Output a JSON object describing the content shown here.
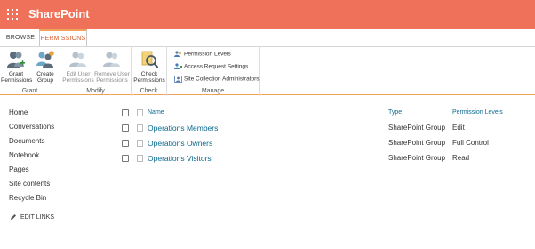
{
  "suite": {
    "app_name": "SharePoint"
  },
  "tabs": [
    {
      "label": "BROWSE"
    },
    {
      "label": "PERMISSIONS"
    }
  ],
  "ribbon": {
    "grant": {
      "label": "Grant",
      "buttons": [
        {
          "label": "Grant Permissions"
        },
        {
          "label": "Create Group"
        }
      ]
    },
    "modify": {
      "label": "Modify",
      "buttons": [
        {
          "label": "Edit User Permissions"
        },
        {
          "label": "Remove User Permissions"
        }
      ]
    },
    "check": {
      "label": "Check",
      "buttons": [
        {
          "label": "Check Permissions"
        }
      ]
    },
    "manage": {
      "label": "Manage",
      "items": [
        {
          "label": "Permission Levels"
        },
        {
          "label": "Access Request Settings"
        },
        {
          "label": "Site Collection Administrators"
        }
      ]
    }
  },
  "nav": {
    "items": [
      {
        "label": "Home"
      },
      {
        "label": "Conversations"
      },
      {
        "label": "Documents"
      },
      {
        "label": "Notebook"
      },
      {
        "label": "Pages"
      },
      {
        "label": "Site contents"
      },
      {
        "label": "Recycle Bin"
      }
    ],
    "edit_links": "EDIT LINKS"
  },
  "table": {
    "columns": {
      "name": "Name",
      "type": "Type",
      "level": "Permission Levels"
    },
    "rows": [
      {
        "name": "Operations Members",
        "type": "SharePoint Group",
        "level": "Edit"
      },
      {
        "name": "Operations Owners",
        "type": "SharePoint Group",
        "level": "Full Control"
      },
      {
        "name": "Operations Visitors",
        "type": "SharePoint Group",
        "level": "Read"
      }
    ]
  },
  "colors": {
    "suite_bar": "#f0715a",
    "accent_tab": "#d75c2b",
    "link": "#0b6a8c"
  }
}
